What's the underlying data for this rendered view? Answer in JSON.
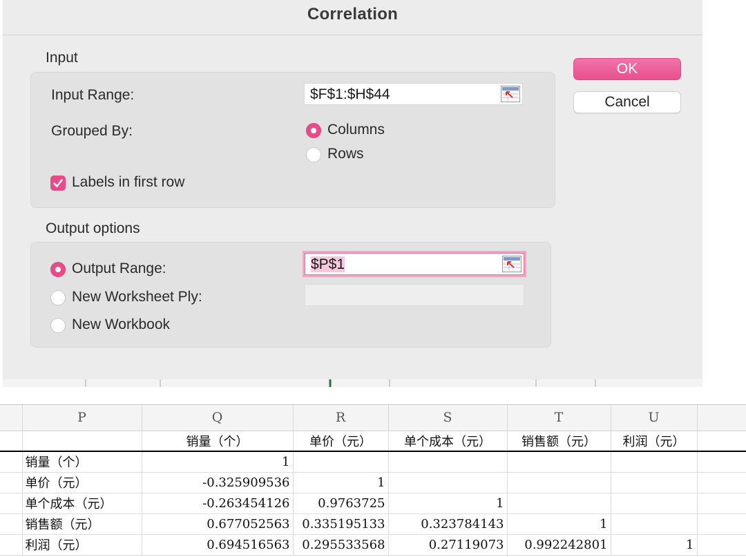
{
  "dialog": {
    "title": "Correlation",
    "input_section": "Input",
    "input_range_label": "Input Range:",
    "input_range_value": "$F$1:$H$44",
    "grouped_by_label": "Grouped By:",
    "grouped_options": [
      "Columns",
      "Rows"
    ],
    "grouped_selected": "Columns",
    "labels_checkbox": "Labels in first row",
    "labels_checked": true,
    "output_section": "Output options",
    "output_options": [
      "Output Range:",
      "New Worksheet Ply:",
      "New Workbook"
    ],
    "output_selected": "Output Range:",
    "output_range_value": "$P$1",
    "ok_label": "OK",
    "cancel_label": "Cancel",
    "accent_color": "#EA4A8A"
  },
  "sheet": {
    "columns": [
      "P",
      "Q",
      "R",
      "S",
      "T",
      "U"
    ],
    "header_row": [
      "",
      "销量（个）",
      "单价（元）",
      "单个成本（元）",
      "销售额（元）",
      "利润（元）"
    ],
    "rows": [
      [
        "销量（个）",
        "1",
        "",
        "",
        "",
        ""
      ],
      [
        "单价（元）",
        "-0.325909536",
        "1",
        "",
        "",
        ""
      ],
      [
        "单个成本（元）",
        "-0.263454126",
        "0.9763725",
        "1",
        "",
        ""
      ],
      [
        "销售额（元）",
        "0.677052563",
        "0.335195133",
        "0.323784143",
        "1",
        ""
      ],
      [
        "利润（元）",
        "0.694516563",
        "0.295533568",
        "0.27119073",
        "0.992242801",
        "1"
      ]
    ]
  }
}
